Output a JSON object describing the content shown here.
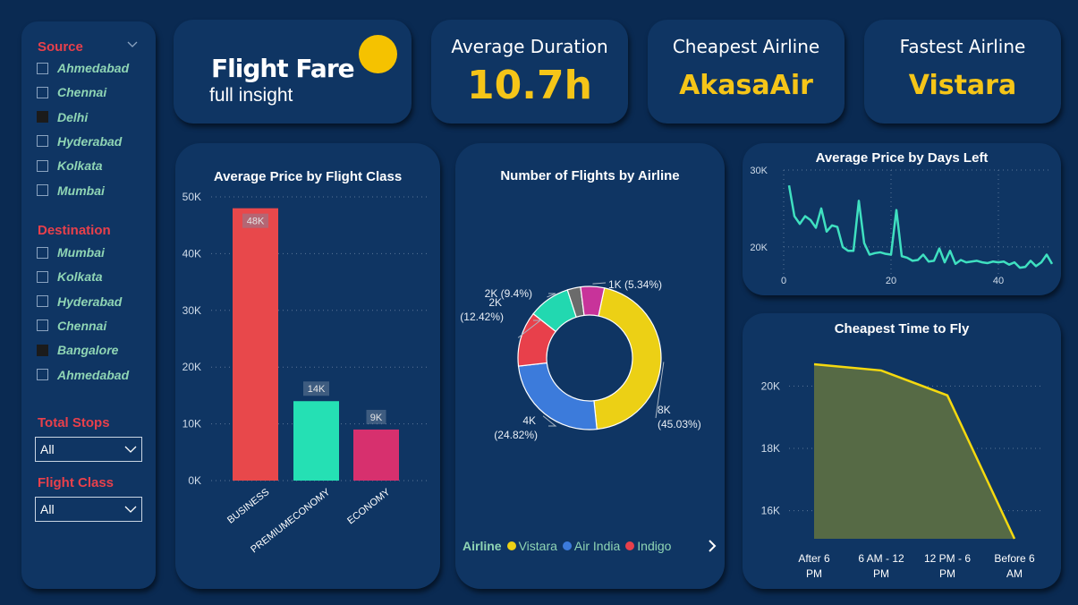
{
  "header": {
    "title": "Flight Fare",
    "subtitle": "full insight"
  },
  "kpis": {
    "duration": {
      "label": "Average Duration",
      "value": "10.7h"
    },
    "cheapest": {
      "label": "Cheapest Airline",
      "value": "AkasaAir"
    },
    "fastest": {
      "label": "Fastest Airline",
      "value": "Vistara"
    }
  },
  "filters": {
    "source": {
      "title": "Source",
      "options": [
        {
          "label": "Ahmedabad",
          "checked": false
        },
        {
          "label": "Chennai",
          "checked": false
        },
        {
          "label": "Delhi",
          "checked": true
        },
        {
          "label": "Hyderabad",
          "checked": false
        },
        {
          "label": "Kolkata",
          "checked": false
        },
        {
          "label": "Mumbai",
          "checked": false
        }
      ]
    },
    "destination": {
      "title": "Destination",
      "options": [
        {
          "label": "Mumbai",
          "checked": false
        },
        {
          "label": "Kolkata",
          "checked": false
        },
        {
          "label": "Hyderabad",
          "checked": false
        },
        {
          "label": "Chennai",
          "checked": false
        },
        {
          "label": "Bangalore",
          "checked": true
        },
        {
          "label": "Ahmedabad",
          "checked": false
        }
      ]
    },
    "total_stops": {
      "title": "Total Stops",
      "value": "All"
    },
    "flight_class": {
      "title": "Flight Class",
      "value": "All"
    }
  },
  "colors": {
    "background": "#0a2a52",
    "card": "#0f3563",
    "accent_yellow": "#f5c518",
    "filter_title": "#e8404b",
    "filter_label": "#8fd5b4",
    "line": "#3fe0c0"
  },
  "chart_data": [
    {
      "type": "bar",
      "title": "Average Price by Flight Class",
      "categories": [
        "BUSINESS",
        "PREMIUMECONOMY",
        "ECONOMY"
      ],
      "values": [
        48000,
        14000,
        9000
      ],
      "data_labels": [
        "48K",
        "14K",
        "9K"
      ],
      "colors": [
        "#e8484b",
        "#25e0b4",
        "#d7306e"
      ],
      "yticks": [
        "0K",
        "10K",
        "20K",
        "30K",
        "40K",
        "50K"
      ],
      "ylim": [
        0,
        50000
      ],
      "grid": true
    },
    {
      "type": "pie",
      "title": "Number of Flights by Airline",
      "donut": true,
      "slices": [
        {
          "name": "Vistara",
          "value": 45.03,
          "label": "8K",
          "pct": "(45.03%)",
          "color": "#ecd015"
        },
        {
          "name": "Air India",
          "value": 24.82,
          "label": "4K",
          "pct": "(24.82%)",
          "color": "#3c7bdb"
        },
        {
          "name": "Indigo",
          "value": 12.42,
          "label": "2K",
          "pct": "(12.42%)",
          "color": "#e8404b"
        },
        {
          "name": "",
          "value": 9.4,
          "label": "2K (9.4%)",
          "pct": "",
          "color": "#22d8b0"
        },
        {
          "name": "",
          "value": 3.0,
          "label": "",
          "pct": "",
          "color": "#6b6b6b"
        },
        {
          "name": "",
          "value": 5.34,
          "label": "1K (5.34%)",
          "pct": "",
          "color": "#c8339a"
        }
      ],
      "legend_title": "Airline",
      "legend_items": [
        "Vistara",
        "Air India",
        "Indigo"
      ],
      "legend_placement": "bottom"
    },
    {
      "type": "line",
      "title": "Average Price by Days Left",
      "x": [
        1,
        2,
        3,
        4,
        5,
        6,
        7,
        8,
        9,
        10,
        11,
        12,
        13,
        14,
        15,
        16,
        17,
        18,
        19,
        20,
        21,
        22,
        23,
        24,
        25,
        26,
        27,
        28,
        29,
        30,
        31,
        32,
        33,
        34,
        35,
        36,
        37,
        38,
        39,
        40,
        41,
        42,
        43,
        44,
        45,
        46,
        47,
        48,
        49,
        50
      ],
      "y": [
        28000,
        24000,
        23000,
        24000,
        23500,
        22500,
        25000,
        22000,
        22800,
        22600,
        20000,
        19500,
        19500,
        26000,
        20500,
        19000,
        19200,
        19300,
        19100,
        19000,
        24800,
        18800,
        18600,
        18200,
        18300,
        19000,
        18100,
        18200,
        19800,
        18000,
        19500,
        17800,
        18300,
        18000,
        18100,
        18200,
        18000,
        17900,
        18100,
        18000,
        18100,
        17700,
        18000,
        17300,
        17400,
        18200,
        17500,
        18000,
        19000,
        17800
      ],
      "xticks": [
        0,
        20,
        40
      ],
      "yticks": [
        "20K",
        "30K"
      ],
      "xlim": [
        0,
        50
      ],
      "ylim": [
        16500,
        30000
      ],
      "grid": true
    },
    {
      "type": "area",
      "title": "Cheapest Time to Fly",
      "categories": [
        "After 6 PM",
        "6 AM - 12 PM",
        "12 PM - 6 PM",
        "Before 6 AM"
      ],
      "values": [
        20700,
        20500,
        19700,
        15100
      ],
      "yticks": [
        "16K",
        "18K",
        "20K"
      ],
      "ylim": [
        15100,
        20900
      ],
      "grid": true
    }
  ]
}
